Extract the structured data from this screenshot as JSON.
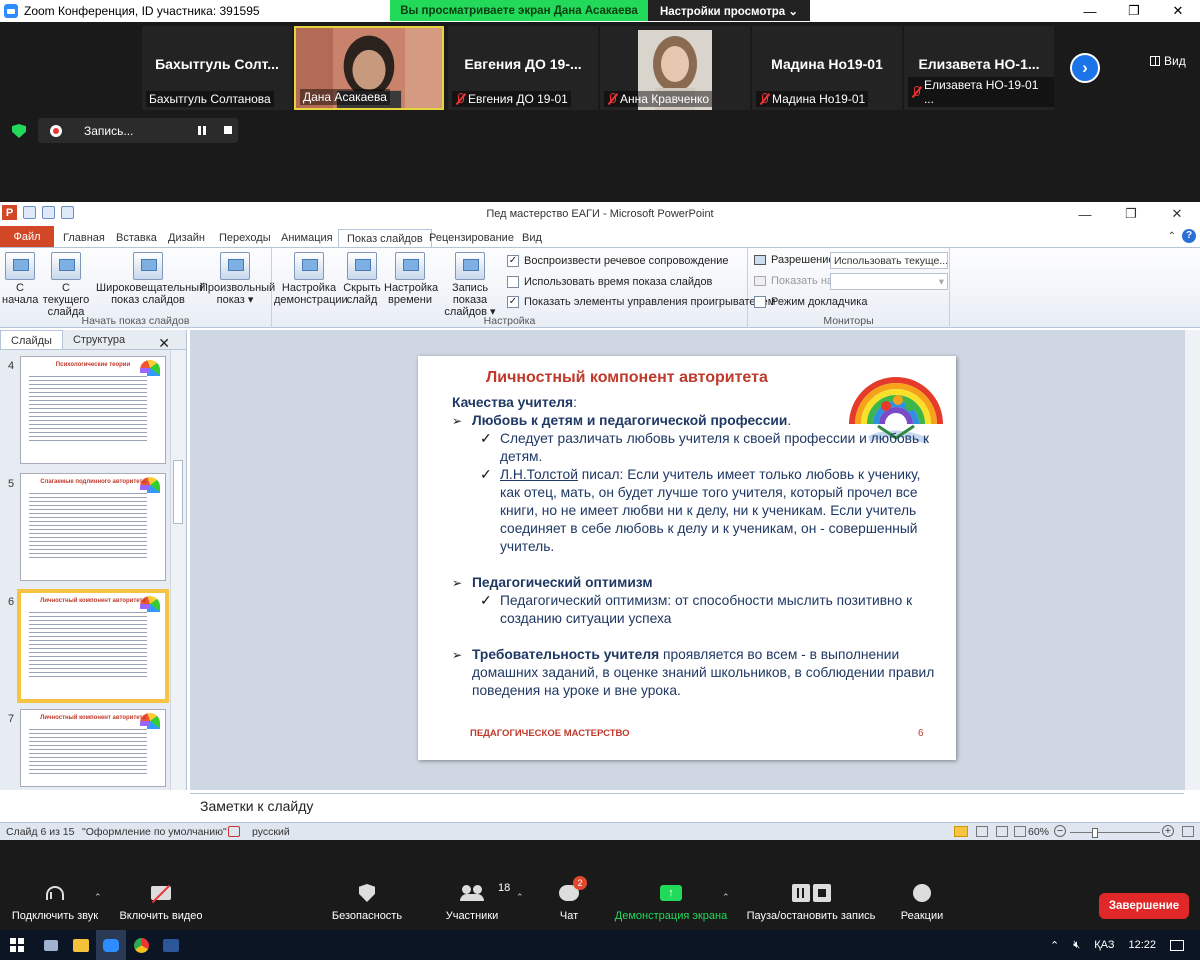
{
  "zoom": {
    "window_title": "Zoom Конференция, ID участника: 391595",
    "banner_viewing": "Вы просматриваете экран Дана Асакаева",
    "banner_settings": "Настройки просмотра ⌄",
    "view_label": "Вид",
    "participants": [
      {
        "big_name": "Бахытгуль  Солт...",
        "caption": "Бахытгуль Солтанова",
        "muted": false,
        "video": false
      },
      {
        "big_name": "",
        "caption": "Дана Асакаева",
        "muted": false,
        "video": true,
        "active": true
      },
      {
        "big_name": "Евгения  ДО  19-...",
        "caption": "Евгения ДО 19-01",
        "muted": true,
        "video": false
      },
      {
        "big_name": "",
        "caption": "Анна Кравченко",
        "muted": true,
        "video": true
      },
      {
        "big_name": "Мадина Но19-01",
        "caption": "Мадина Но19-01",
        "muted": true,
        "video": false
      },
      {
        "big_name": "Елизавета  НО-1...",
        "caption": "Елизавета НО-19-01 ...",
        "muted": true,
        "video": false
      }
    ],
    "recording_label": "Запись...",
    "toolbar": {
      "audio": "Подключить звук",
      "video": "Включить видео",
      "security": "Безопасность",
      "participants": "Участники",
      "participants_count": "18",
      "chat": "Чат",
      "chat_badge": "2",
      "share": "Демонстрация экрана",
      "pause": "Пауза/остановить запись",
      "reactions": "Реакции",
      "end": "Завершение"
    }
  },
  "ppt": {
    "title": "Пед мастерство ЕАГИ  -  Microsoft PowerPoint",
    "tabs": [
      "Файл",
      "Главная",
      "Вставка",
      "Дизайн",
      "Переходы",
      "Анимация",
      "Показ слайдов",
      "Рецензирование",
      "Вид"
    ],
    "ribbon": {
      "start_from_beginning": "С начала",
      "from_current": "С текущего слайда",
      "broadcast": "Широковещательный показ слайдов",
      "custom": "Произвольный показ ▾",
      "group_start": "Начать показ слайдов",
      "setup": "Настройка демонстрации",
      "hide": "Скрыть слайд",
      "timings": "Настройка времени",
      "record": "Запись показа слайдов ▾",
      "check_narration": "Воспроизвести речевое сопровождение",
      "check_timings": "Использовать время показа слайдов",
      "check_controls": "Показать элементы управления проигрывателем",
      "group_setup": "Настройка",
      "resolution_label": "Разрешение:",
      "resolution_value": "Использовать текуще...",
      "show_on_label": "Показать на:",
      "presenter_view": "Режим докладчика",
      "group_monitors": "Мониторы"
    },
    "pane_tabs": [
      "Слайды",
      "Структура"
    ],
    "thumbs": [
      {
        "num": "4",
        "title": "Психологические теории"
      },
      {
        "num": "5",
        "title": "Слагаемые подлинного авторитета"
      },
      {
        "num": "6",
        "title": "Личностный компонент авторитета",
        "selected": true
      },
      {
        "num": "7",
        "title": "Личностный компонент авторитета"
      }
    ],
    "slide": {
      "title": "Личностный компонент авторитета",
      "intro": "Качества учителя",
      "intro_colon": ":",
      "b1": "Любовь к детям и педагогической профессии",
      "b1_end": ".",
      "b1_s1": "Следует различать любовь учителя к своей профессии и любовь к детям.",
      "b1_s2_link": "Л.Н.Толстой",
      "b1_s2": " писал: Если учитель имеет только любовь к ученику, как отец, мать, он будет лучше того учителя, который прочел все книги, но не имеет любви ни к делу, ни к ученикам. Если учитель соединяет  в себе любовь к делу и к ученикам, он - совершенный учитель.",
      "b2": "Педагогический оптимизм",
      "b2_s1": "Педагогический оптимизм: от способности мыслить позитивно к созданию ситуации успеха",
      "b3": "Требовательность учителя",
      "b3_rest": " проявляется во всем - в выполнении домашних заданий, в оценке знаний школьников, в соблюдении правил поведения на уроке и вне урока.",
      "footer": "ПЕДАГОГИЧЕСКОЕ МАСТЕРСТВО",
      "number": "6"
    },
    "notes": "Заметки к слайду",
    "status": {
      "slide": "Слайд 6 из 15",
      "theme": "\"Оформление по умолчанию\"",
      "lang": "русский",
      "zoom": "60%"
    }
  },
  "taskbar": {
    "lang": "ҚАЗ",
    "time": "12:22"
  }
}
